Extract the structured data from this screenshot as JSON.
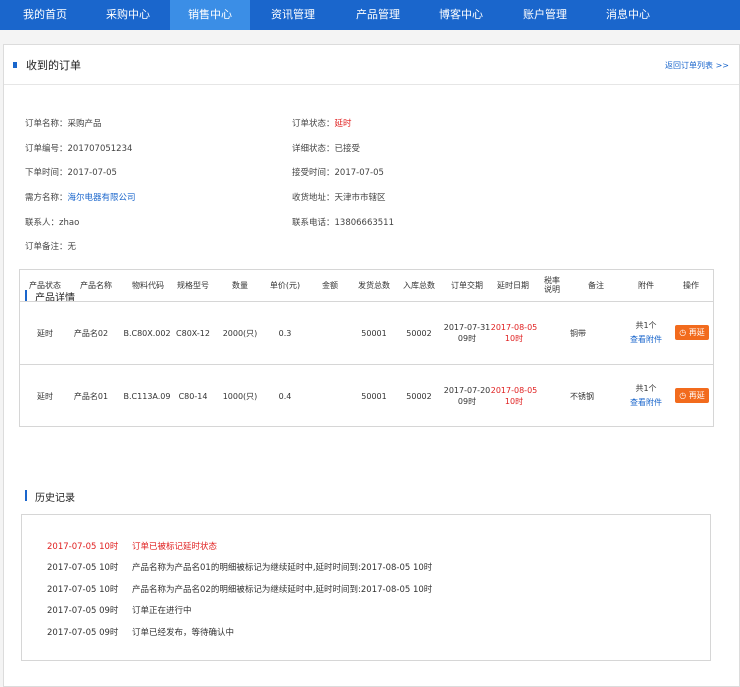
{
  "nav": [
    {
      "label": "我的首页",
      "active": false
    },
    {
      "label": "采购中心",
      "active": false
    },
    {
      "label": "销售中心",
      "active": true
    },
    {
      "label": "资讯管理",
      "active": false
    },
    {
      "label": "产品管理",
      "active": false
    },
    {
      "label": "博客中心",
      "active": false
    },
    {
      "label": "账户管理",
      "active": false
    },
    {
      "label": "消息中心",
      "active": false
    }
  ],
  "header": {
    "title": "收到的订单",
    "back_link": "返回订单列表 >>"
  },
  "order": {
    "name_label": "订单名称：",
    "name": "采购产品",
    "no_label": "订单编号：",
    "no": "201707051234",
    "order_time_label": "下单时间：",
    "order_time": "2017-07-05",
    "buyer_label": "需方名称：",
    "buyer": "海尔电器有限公司",
    "contact_label": "联系人：",
    "contact": "zhao",
    "remark_label": "订单备注：",
    "remark": "无",
    "status_label": "订单状态：",
    "status": "延时",
    "detail_status_label": "详细状态：",
    "detail_status": "已接受",
    "accept_time_label": "接受时间：",
    "accept_time": "2017-07-05",
    "address_label": "收货地址：",
    "address": "天津市市辖区",
    "phone_label": "联系电话：",
    "phone": "13806663511"
  },
  "products": {
    "title": "产品详情",
    "columns": [
      "产品状态",
      "产品名称",
      "物料代码",
      "规格型号",
      "数量",
      "单价(元)",
      "金额",
      "发货总数",
      "入库总数",
      "订单交期",
      "延时日期",
      "税率\n说明",
      "备注",
      "附件",
      "操作"
    ],
    "rows": [
      {
        "status": "延时",
        "name": "产品名02",
        "code": "B.C80X.002",
        "spec": "C80X-12",
        "qty": "2000(只)",
        "price": "0.3",
        "amount": "",
        "shipped": "50001",
        "stored": "50002",
        "due": "2017-07-31\n09时",
        "delay": "2017-08-05\n10时",
        "tax": "",
        "note": "铜带",
        "attach_count": "共1个",
        "attach_link": "查看附件",
        "action": "再延"
      },
      {
        "status": "延时",
        "name": "产品名01",
        "code": "B.C113A.09",
        "spec": "C80-14",
        "qty": "1000(只)",
        "price": "0.4",
        "amount": "",
        "shipped": "50001",
        "stored": "50002",
        "due": "2017-07-20\n09时",
        "delay": "2017-08-05\n10时",
        "tax": "",
        "note": "不锈钢",
        "attach_count": "共1个",
        "attach_link": "查看附件",
        "action": "再延"
      }
    ]
  },
  "history": {
    "title": "历史记录",
    "entries": [
      {
        "time": "2017-07-05 10时",
        "text": "订单已被标记延时状态",
        "highlight": true
      },
      {
        "time": "2017-07-05 10时",
        "text": "产品名称为产品名01的明细被标记为继续延时中,延时时间到:2017-08-05 10时",
        "highlight": false
      },
      {
        "time": "2017-07-05 10时",
        "text": "产品名称为产品名02的明细被标记为继续延时中,延时时间到:2017-08-05 10时",
        "highlight": false
      },
      {
        "time": "2017-07-05 09时",
        "text": "订单正在进行中",
        "highlight": false
      },
      {
        "time": "2017-07-05 09时",
        "text": "订单已经发布，等待确认中",
        "highlight": false
      }
    ]
  },
  "colors": {
    "primary": "#1a66cc",
    "nav_active": "#3b8ee6",
    "accent_red": "#e02020",
    "button_orange": "#f26b1d"
  }
}
